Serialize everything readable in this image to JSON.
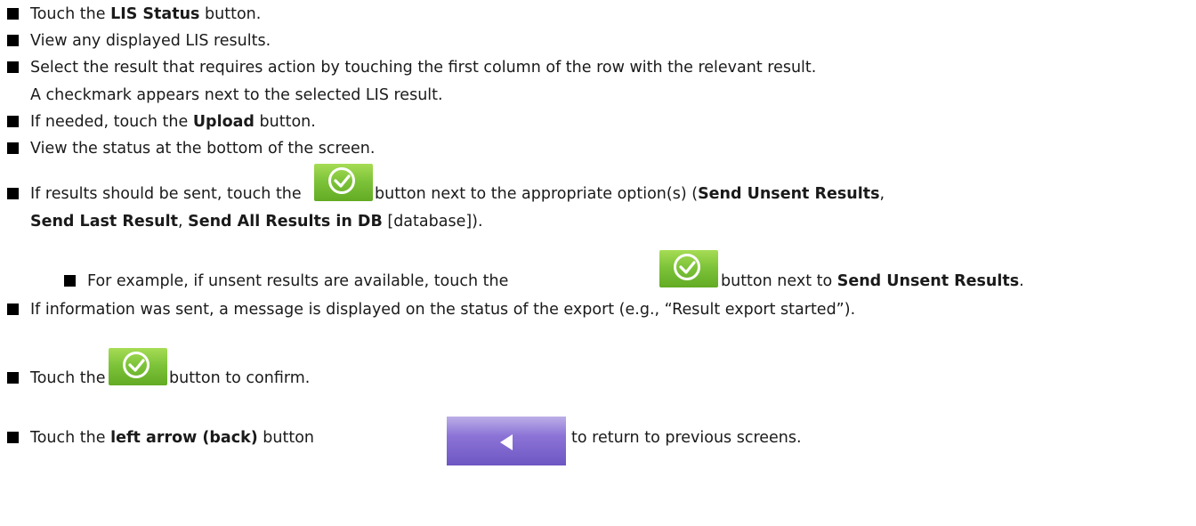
{
  "steps": [
    {
      "pre": "Touch the ",
      "bold": "LIS Status",
      "post": " button."
    },
    {
      "text": "View any displayed LIS results."
    },
    {
      "text": "Select the result that requires action by touching the first column of the row with the relevant result.",
      "cont": "A checkmark appears next to the selected LIS result."
    },
    {
      "pre": "If needed, touch the ",
      "bold": "Upload",
      "post": " button."
    },
    {
      "text": "View the status at the bottom of the screen."
    },
    {
      "pre": "If results should be sent, touch the ",
      "mid": " button next to the appropriate option(s) (",
      "b1": "Send Unsent Results",
      "comma": ",",
      "b2": "Send Last Result",
      "sep": ", ",
      "b3": "Send All Results in DB",
      "end": " [database])."
    },
    {
      "pre": "For example, if unsent results are available, touch the ",
      "mid": " button next to ",
      "bold": "Send Unsent Results",
      "post": "."
    },
    {
      "text": "If information was sent, a message is displayed on the status of the export (e.g., “Result export started”)."
    },
    {
      "pre": "Touch the ",
      "post": " button to confirm."
    },
    {
      "pre": "Touch the ",
      "bold": "left arrow (back)",
      "mid": " button ",
      "post": " to return to previous screens."
    }
  ],
  "icons": {
    "confirm": "checkmark-circle-icon",
    "back": "left-arrow-icon"
  },
  "colors": {
    "confirm_button": "#7ec43a",
    "back_button": "#8b73d6",
    "bullet": "#000000"
  }
}
